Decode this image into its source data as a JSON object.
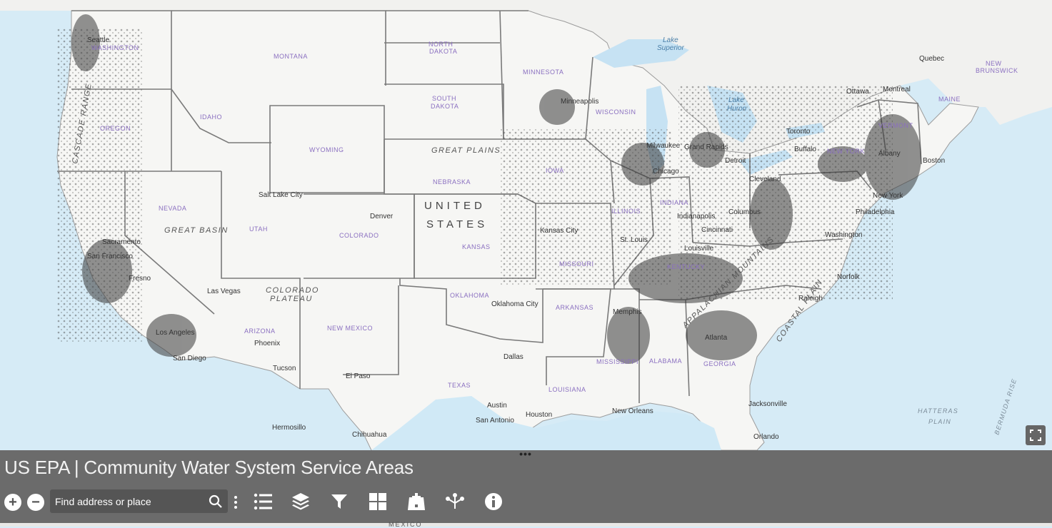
{
  "app": {
    "title": "US EPA | Community Water System Service Areas"
  },
  "search": {
    "placeholder": "Find address or place",
    "icon": "search-icon"
  },
  "toolbar": {
    "zoom_in": "+",
    "zoom_out": "−",
    "more_icon": "more-vertical-icon",
    "tools": [
      {
        "name": "legend",
        "icon": "legend-list-icon"
      },
      {
        "name": "layers",
        "icon": "layers-icon"
      },
      {
        "name": "filter",
        "icon": "filter-icon"
      },
      {
        "name": "basemap",
        "icon": "basemap-gallery-icon"
      },
      {
        "name": "bookmark",
        "icon": "bookmark-add-icon"
      },
      {
        "name": "share",
        "icon": "share-icon"
      },
      {
        "name": "about",
        "icon": "info-icon"
      }
    ],
    "grip": "•••"
  },
  "map": {
    "fullscreen_icon": "fullscreen-icon",
    "country_labels": [
      "UNITED",
      "STATES"
    ],
    "bottom_country_label": "MEXICO",
    "states": [
      "WASHINGTON",
      "OREGON",
      "IDAHO",
      "MONTANA",
      "WYOMING",
      "NORTH DAKOTA",
      "SOUTH DAKOTA",
      "NEBRASKA",
      "KANSAS",
      "OKLAHOMA",
      "TEXAS",
      "MINNESOTA",
      "IOWA",
      "MISSOURI",
      "ARKANSAS",
      "LOUISIANA",
      "WISCONSIN",
      "ILLINOIS",
      "INDIANA",
      "KENTUCKY",
      "MISSISSIPPI",
      "ALABAMA",
      "GEORGIA",
      "NEVADA",
      "UTAH",
      "COLORADO",
      "ARIZONA",
      "NEW MEXICO",
      "VERMONT",
      "NEW YORK",
      "MAINE",
      "NEW BRUNSWICK"
    ],
    "cities": [
      "Seattle",
      "Sacramento",
      "San Francisco",
      "Fresno",
      "Los Angeles",
      "San Diego",
      "Las Vegas",
      "Salt Lake City",
      "Phoenix",
      "Tucson",
      "Hermosillo",
      "Chihuahua",
      "El Paso",
      "Denver",
      "Kansas City",
      "Oklahoma City",
      "Dallas",
      "Austin",
      "San Antonio",
      "Houston",
      "New Orleans",
      "Memphis",
      "St. Louis",
      "Minneapolis",
      "Milwaukee",
      "Chicago",
      "Grand Rapids",
      "Detroit",
      "Indianapolis",
      "Cincinnati",
      "Louisville",
      "Columbus",
      "Cleveland",
      "Toronto",
      "Buffalo",
      "Ottawa",
      "Montreal",
      "Quebec",
      "Albany",
      "Boston",
      "New York",
      "Philadelphia",
      "Washington",
      "Norfolk",
      "Raleigh",
      "Atlanta",
      "Jacksonville",
      "Orlando"
    ],
    "water": [
      "Lake Superior",
      "Lake Huron"
    ],
    "regions": [
      "GREAT PLAINS",
      "GREAT BASIN",
      "COLORADO PLATEAU",
      "CASCADE RANGE",
      "APPALACHIAN MOUNTAINS",
      "COASTAL PLAIN"
    ],
    "ocean": [
      "HATTERAS PLAIN",
      "BERMUDA RISE"
    ]
  }
}
